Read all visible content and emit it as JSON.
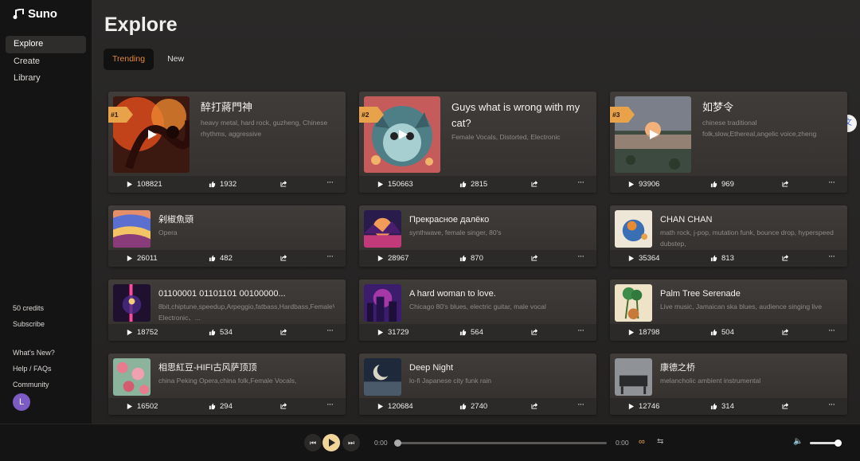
{
  "app": {
    "name": "Suno"
  },
  "sidebar": {
    "items": [
      {
        "label": "Explore",
        "active": true
      },
      {
        "label": "Create"
      },
      {
        "label": "Library"
      }
    ],
    "credits": "50 credits",
    "subscribe": "Subscribe",
    "whats_new": "What's New?",
    "help": "Help / FAQs",
    "community": "Community",
    "avatar_letter": "L"
  },
  "header": {
    "title": "Explore",
    "tabs": [
      {
        "label": "Trending",
        "active": true
      },
      {
        "label": "New"
      }
    ]
  },
  "translate_icon": "translate-icon",
  "accent": "#e8a24a",
  "songs": [
    {
      "rank": "#1",
      "title": "醉打蔣門神",
      "tags": "heavy metal, hard rock, guzheng, Chinese rhythms, aggressive",
      "plays": "108821",
      "likes": "1932",
      "art": "dragon"
    },
    {
      "rank": "#2",
      "title": "Guys what is wrong with my cat?",
      "tags": "Female Vocals, Distorted, Electronic",
      "plays": "150663",
      "likes": "2815",
      "art": "cat"
    },
    {
      "rank": "#3",
      "title": "如梦令",
      "tags": "chinese traditional folk,slow,Ethereal,angelic voice,zheng",
      "plays": "93906",
      "likes": "969",
      "art": "lake"
    },
    {
      "title": "剁椒魚頭",
      "tags": "Opera",
      "plays": "26011",
      "likes": "482",
      "art": "waves"
    },
    {
      "title": "Прекрасное далёко",
      "tags": "synthwave, female singer, 80's",
      "plays": "28967",
      "likes": "870",
      "art": "synth"
    },
    {
      "title": "CHAN CHAN",
      "tags": "math rock, j-pop, mutation funk, bounce drop, hyperspeed dubstep,",
      "plays": "35364",
      "likes": "813",
      "art": "bird"
    },
    {
      "title": "01100001 01101101 00100000...",
      "tags": "8bit,chiptune,speedup,Arpeggio,fatbass,Hardbass,FemaleVocals,synthesizer、Electronic、...",
      "plays": "18752",
      "likes": "534",
      "art": "neon"
    },
    {
      "title": "A hard woman to love.",
      "tags": "Chicago 80's blues, electric guitar, male vocal",
      "plays": "31729",
      "likes": "564",
      "art": "city"
    },
    {
      "title": "Palm Tree Serenade",
      "tags": "Live music, Jamaican ska blues, audience singing live",
      "plays": "18798",
      "likes": "504",
      "art": "palm"
    },
    {
      "title": "相思紅豆-HIFI古风萨顶顶",
      "tags": "china Peking Opera,china folk,Female Vocals,",
      "plays": "16502",
      "likes": "294",
      "art": "flowers"
    },
    {
      "title": "Deep Night",
      "tags": "lo-fi Japanese city funk rain",
      "plays": "120684",
      "likes": "2740",
      "art": "moon"
    },
    {
      "title": "康德之桥",
      "tags": "melancholic ambient instrumental",
      "plays": "12746",
      "likes": "314",
      "art": "piano"
    }
  ],
  "player": {
    "current_time": "0:00",
    "duration": "0:00",
    "progress": 0,
    "volume": 1.0
  }
}
